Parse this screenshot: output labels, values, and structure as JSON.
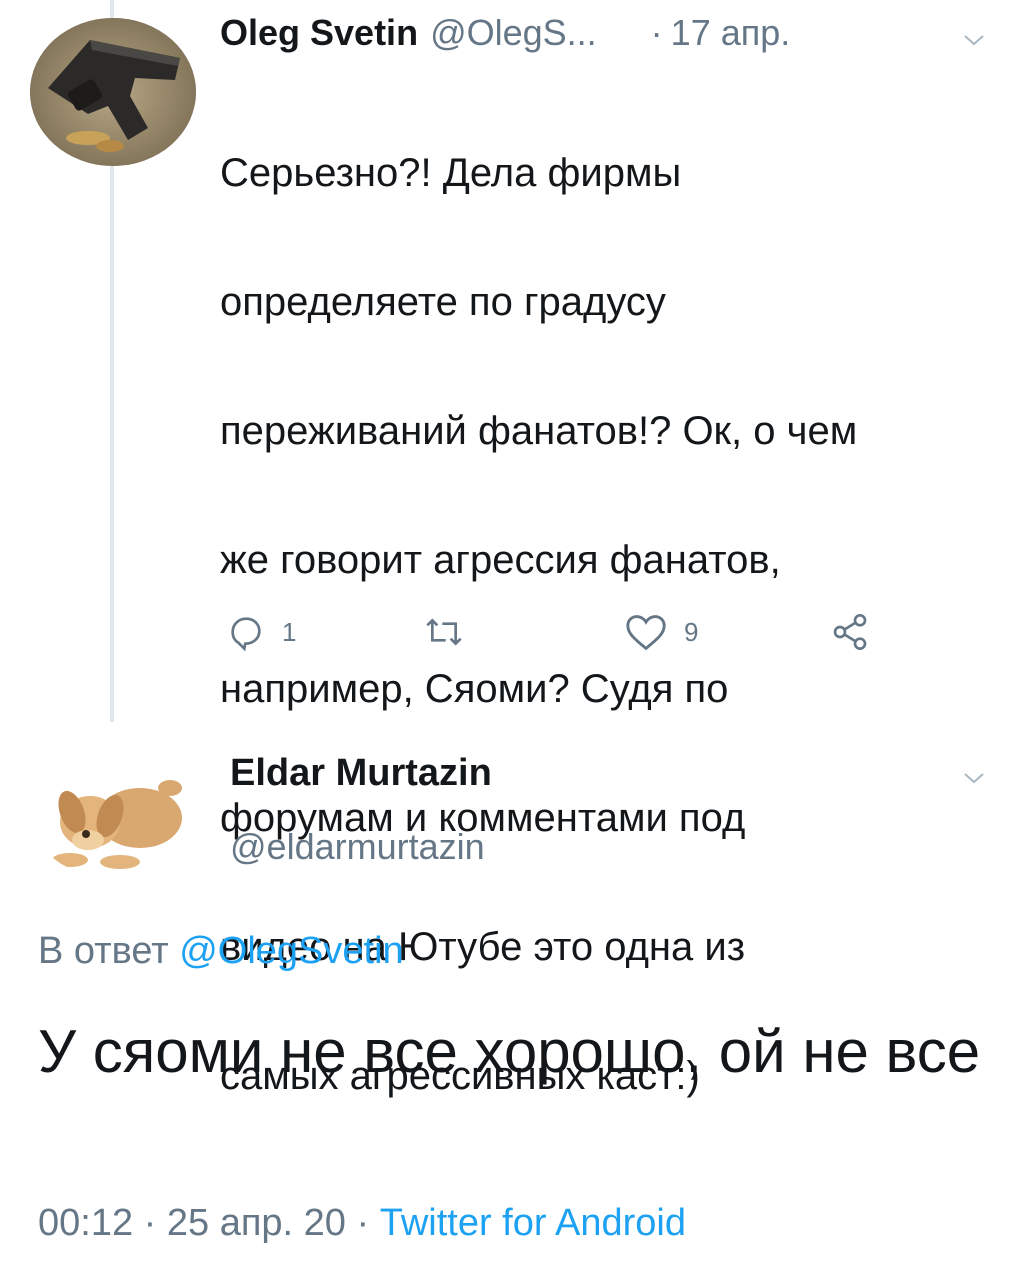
{
  "parent_tweet": {
    "author_name": "Oleg Svetin",
    "handle": "@OlegS...",
    "separator": "·",
    "date": "17 апр.",
    "text_lines": [
      "Серьезно?! Дела фирмы",
      "определяете по градусу",
      "переживаний фанатов!? Ок, о чем",
      "же говорит агрессия фанатов,",
      "например, Сяоми? Судя по",
      "форумам и комментами под",
      "видео на Ютубе это одна из",
      "самых агрессивных каст:)"
    ],
    "actions": {
      "reply_icon": "reply-icon",
      "reply_count": "1",
      "retweet_icon": "retweet-icon",
      "like_icon": "heart-icon",
      "like_count": "9",
      "share_icon": "share-icon"
    }
  },
  "main_tweet": {
    "author_name": "Eldar Murtazin",
    "handle": "@eldarmurtazin",
    "reply_prefix": "В ответ",
    "reply_mention": "@OlegSvetin",
    "text": "У сяоми не все хорошо, ой не все",
    "time": "00:12",
    "separator1": "·",
    "date": "25 апр. 20",
    "separator2": "·",
    "source": "Twitter for Android"
  },
  "colors": {
    "text": "#14171a",
    "secondary": "#657786",
    "link": "#1da1f2",
    "thread_line": "#e1e8ed"
  }
}
